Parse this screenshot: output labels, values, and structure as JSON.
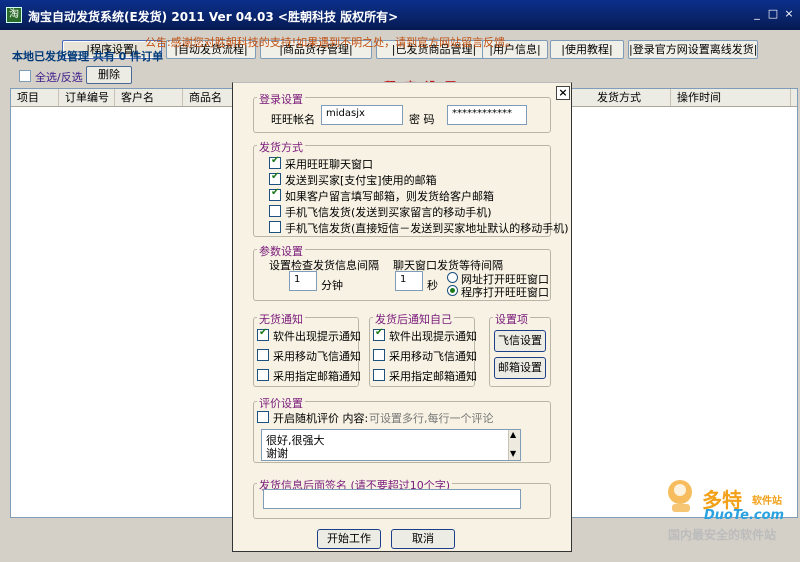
{
  "window": {
    "title": "淘宝自动发货系统(E发货) 2011 Ver 04.03 <胜朝科技 版权所有>",
    "controls": [
      "_",
      "□",
      "×"
    ]
  },
  "tabs": [
    {
      "label": "|程序设置|"
    },
    {
      "label": "|自动发货流程|"
    },
    {
      "label": "|商品货存管理|"
    },
    {
      "label": "|已发货商品管理|"
    },
    {
      "label": "|用户信息|"
    },
    {
      "label": "|使用教程|"
    },
    {
      "label": "|登录官方网设置离线发货|"
    }
  ],
  "notice": "公告:感谢您对胜朝科技的支持!如果遇到不明之处，请到官方网站留言反馈。",
  "section": {
    "title": "本地已发货管理  共有 0 件订单",
    "select_all": "全选/反选",
    "delete": "删除"
  },
  "table": {
    "columns": [
      "项目",
      "订单编号",
      "客户名",
      "商品名",
      "发货方式",
      "操作时间"
    ]
  },
  "dialog": {
    "title": "程 序 设 置",
    "close": "×",
    "login": {
      "legend": "登录设置",
      "account_label": "旺旺帐名",
      "account_value": "midasjx",
      "password_label": "密  码",
      "password_value": "************"
    },
    "ship_method": {
      "legend": "发货方式",
      "options": [
        {
          "label": "采用旺旺聊天窗口",
          "checked": true
        },
        {
          "label": "发送到买家[支付宝]使用的邮箱",
          "checked": true
        },
        {
          "label": "如果客户留言填写邮箱，则发货给客户邮箱",
          "checked": true
        },
        {
          "label": "手机飞信发货(发送到买家留言的移动手机)",
          "checked": false
        },
        {
          "label": "手机飞信发货(直接短信－发送到买家地址默认的移动手机)",
          "checked": false
        }
      ]
    },
    "params": {
      "legend": "参数设置",
      "check_interval_label": "设置检查发货信息间隔",
      "check_interval_value": "1",
      "check_interval_unit": "分钟",
      "chat_wait_label": "聊天窗口发货等待间隔",
      "chat_wait_value": "1",
      "chat_wait_unit": "秒",
      "radio_url": "网址打开旺旺窗口",
      "radio_program": "程序打开旺旺窗口"
    },
    "no_stock": {
      "legend": "无货通知",
      "options": [
        {
          "label": "软件出现提示通知",
          "checked": true
        },
        {
          "label": "采用移动飞信通知",
          "checked": false
        },
        {
          "label": "采用指定邮箱通知",
          "checked": false
        }
      ]
    },
    "after_ship": {
      "legend": "发货后通知自己",
      "options": [
        {
          "label": "软件出现提示通知",
          "checked": true
        },
        {
          "label": "采用移动飞信通知",
          "checked": false
        },
        {
          "label": "采用指定邮箱通知",
          "checked": false
        }
      ]
    },
    "settings": {
      "legend": "设置项",
      "fetion_btn": "飞信设置",
      "mailbox_btn": "邮箱设置"
    },
    "review": {
      "legend": "评价设置",
      "enable_label": "开启随机评价 内容:",
      "hint": "可设置多行,每行一个评论",
      "lines": [
        "很好,很强大",
        "谢谢"
      ]
    },
    "signature": {
      "legend": "发货信息后面签名 (请不要超过10个字)",
      "value": ""
    },
    "start_btn": "开始工作",
    "cancel_btn": "取消"
  },
  "watermark": "www.DuoTe.com",
  "brand": {
    "name": "多特",
    "sub": "软件站",
    "url": "DuoTe.com",
    "slogan": "国内最安全的软件站"
  }
}
